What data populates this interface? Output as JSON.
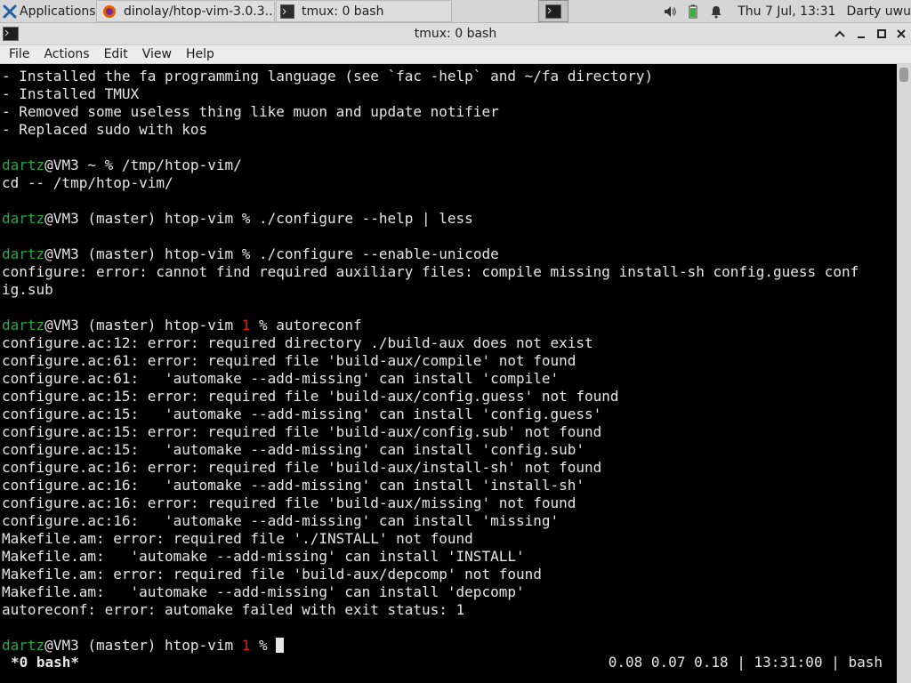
{
  "panel": {
    "apps_label": "Applications",
    "task_browser": "dinolay/htop-vim-3.0.3....",
    "task_tmux": "tmux: 0 bash",
    "clock": "Thu  7 Jul, 13:31",
    "user": "Darty uwu"
  },
  "window": {
    "title": "tmux: 0 bash"
  },
  "menu": [
    "File",
    "Actions",
    "Edit",
    "View",
    "Help"
  ],
  "terminal": {
    "user": "dartz",
    "lines": [
      "- Installed the fa programming language (see `fac -help` and ~/fa directory)",
      "- Installed TMUX",
      "- Removed some useless thing like muon and update notifier",
      "- Replaced sudo with kos",
      "",
      "@VM3 ~ % /tmp/htop-vim/",
      "cd -- /tmp/htop-vim/",
      "",
      "@VM3 (master) htop-vim % ./configure --help | less",
      "",
      "@VM3 (master) htop-vim % ./configure --enable-unicode",
      "configure: error: cannot find required auxiliary files: compile missing install-sh config.guess conf",
      "ig.sub",
      "",
      "@VM3 (master) htop-vim ",
      "1",
      " % autoreconf",
      "configure.ac:12: error: required directory ./build-aux does not exist",
      "configure.ac:61: error: required file 'build-aux/compile' not found",
      "configure.ac:61:   'automake --add-missing' can install 'compile'",
      "configure.ac:15: error: required file 'build-aux/config.guess' not found",
      "configure.ac:15:   'automake --add-missing' can install 'config.guess'",
      "configure.ac:15: error: required file 'build-aux/config.sub' not found",
      "configure.ac:15:   'automake --add-missing' can install 'config.sub'",
      "configure.ac:16: error: required file 'build-aux/install-sh' not found",
      "configure.ac:16:   'automake --add-missing' can install 'install-sh'",
      "configure.ac:16: error: required file 'build-aux/missing' not found",
      "configure.ac:16:   'automake --add-missing' can install 'missing'",
      "Makefile.am: error: required file './INSTALL' not found",
      "Makefile.am:   'automake --add-missing' can install 'INSTALL'",
      "Makefile.am: error: required file 'build-aux/depcomp' not found",
      "Makefile.am:   'automake --add-missing' can install 'depcomp'",
      "autoreconf: error: automake failed with exit status: 1",
      "",
      "@VM3 (master) htop-vim ",
      "1",
      " % "
    ]
  },
  "status": {
    "window": "*0 bash*",
    "right": "0.08 0.07 0.18 | 13:31:00 | bash"
  },
  "colors": {
    "prompt_user": "#24a84a",
    "exit_code": "#e21b1b",
    "terminal_bg": "#000000",
    "panel_bg": "#d6d6d6"
  },
  "icons": [
    "xfce-icon",
    "firefox-icon",
    "terminal-icon",
    "volume-icon",
    "battery-icon",
    "bell-icon"
  ]
}
